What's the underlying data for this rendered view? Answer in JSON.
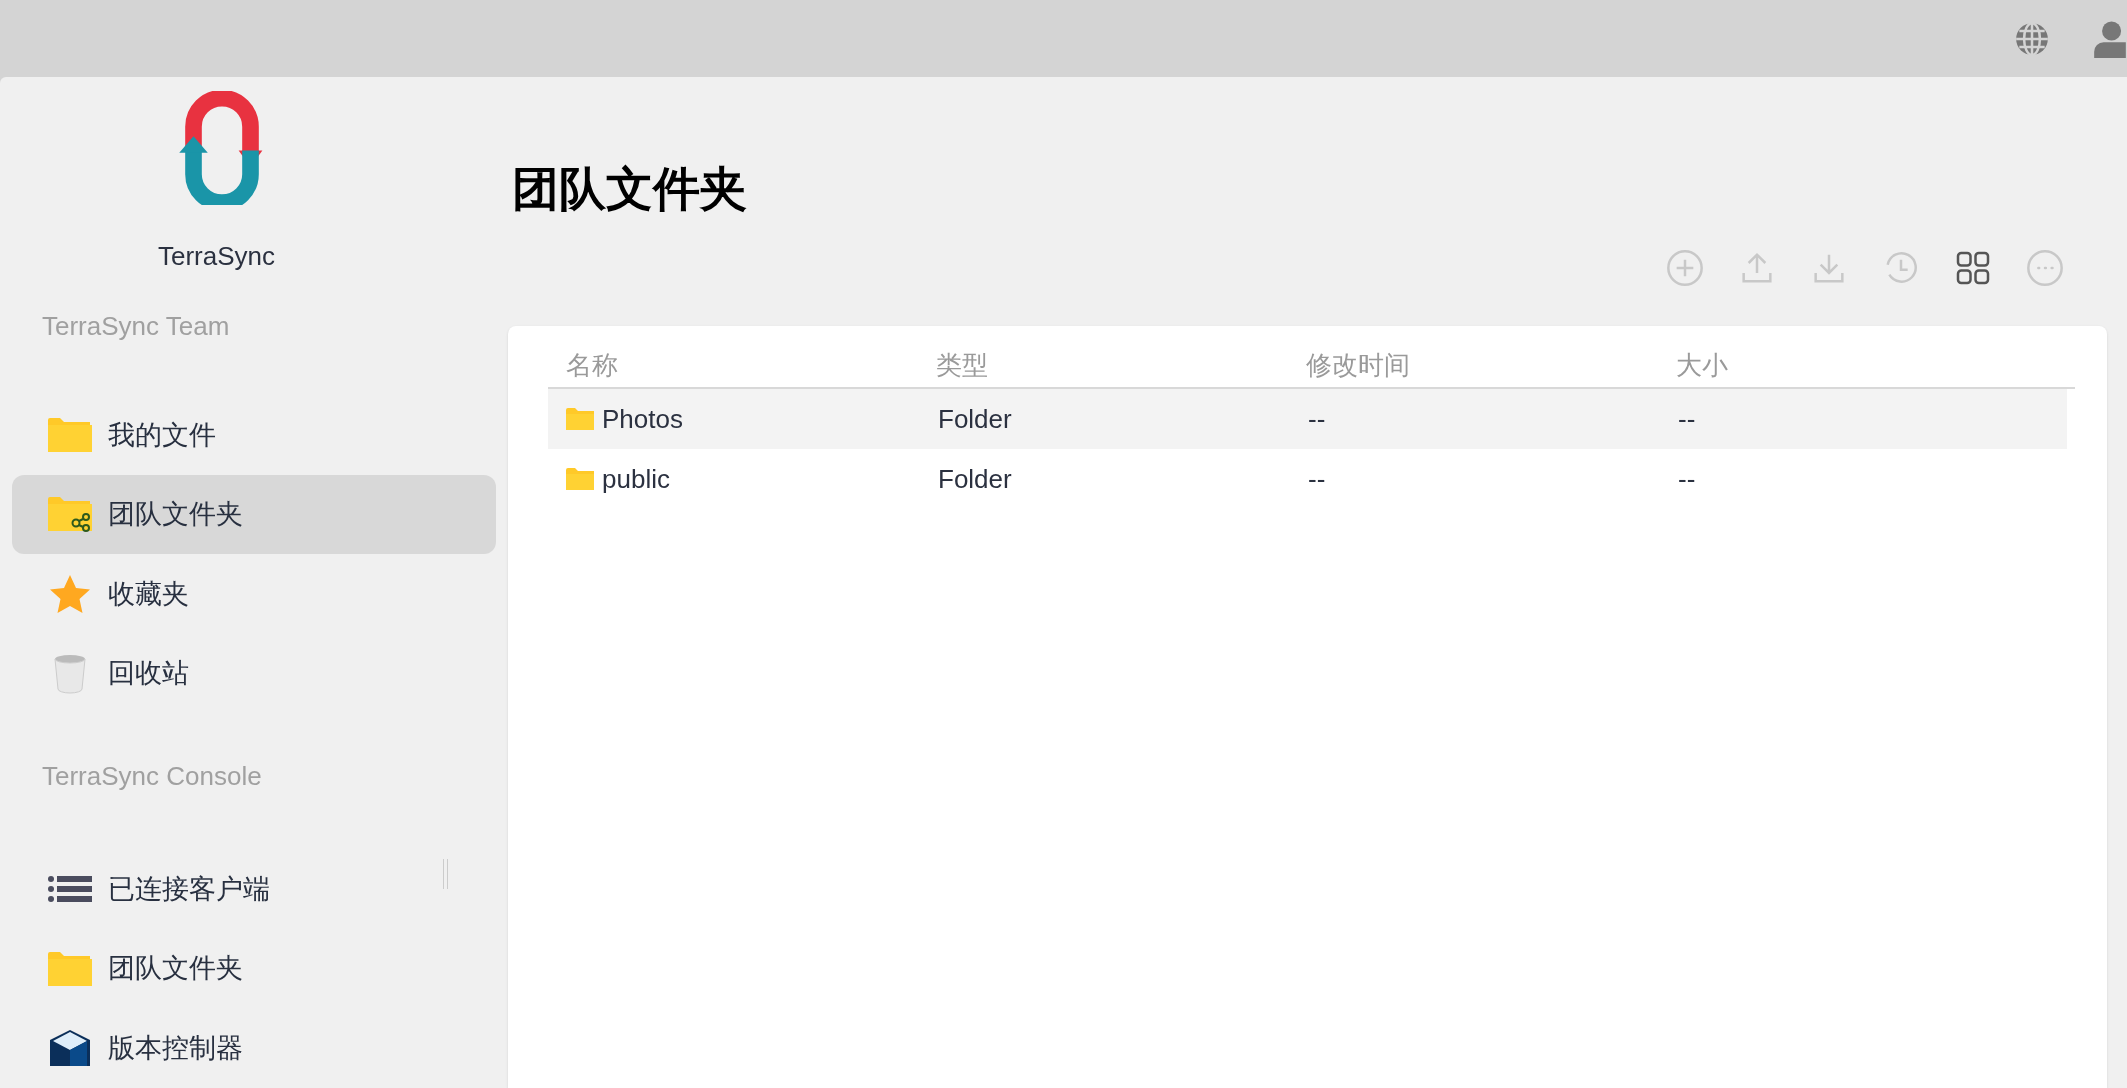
{
  "app": {
    "name": "TerraSync"
  },
  "sidebar": {
    "sections": [
      {
        "heading": "TerraSync Team",
        "items": [
          {
            "label": "我的文件",
            "kind": "folder",
            "selected": false
          },
          {
            "label": "团队文件夹",
            "kind": "shared-folder",
            "selected": true
          },
          {
            "label": "收藏夹",
            "kind": "star",
            "selected": false
          },
          {
            "label": "回收站",
            "kind": "bin",
            "selected": false
          }
        ]
      },
      {
        "heading": "TerraSync Console",
        "items": [
          {
            "label": "已连接客户端",
            "kind": "list",
            "selected": false
          },
          {
            "label": "团队文件夹",
            "kind": "folder",
            "selected": false
          },
          {
            "label": "版本控制器",
            "kind": "cube",
            "selected": false
          }
        ]
      }
    ]
  },
  "page_title": "团队文件夹",
  "toolbar": [
    {
      "kind": "add",
      "disabled": true
    },
    {
      "kind": "upload",
      "disabled": true
    },
    {
      "kind": "download",
      "disabled": true
    },
    {
      "kind": "history",
      "disabled": true
    },
    {
      "kind": "grid",
      "disabled": false
    },
    {
      "kind": "more",
      "disabled": true
    }
  ],
  "table": {
    "columns": [
      "名称",
      "类型",
      "修改时间",
      "大小"
    ],
    "rows": [
      {
        "name": "Photos",
        "type": "Folder",
        "modified": "--",
        "size": "--",
        "selected": true
      },
      {
        "name": "public",
        "type": "Folder",
        "modified": "--",
        "size": "--",
        "selected": false
      }
    ]
  }
}
